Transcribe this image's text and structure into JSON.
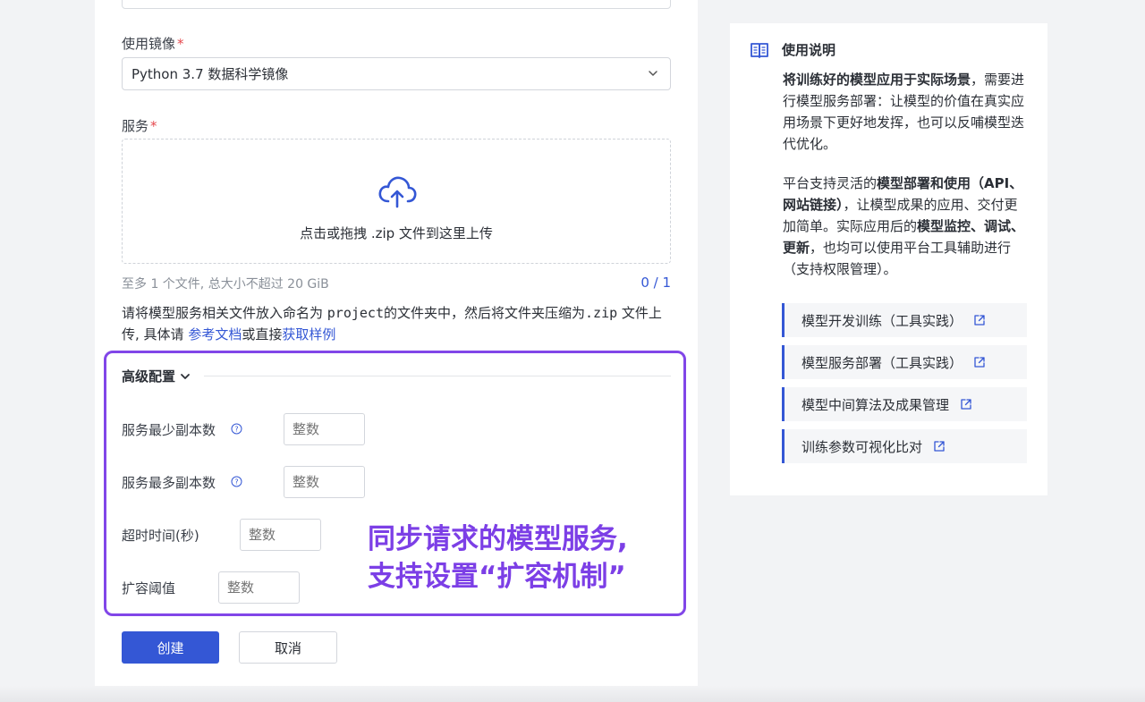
{
  "form": {
    "image_label": "使用镜像",
    "image_value": "Python 3.7 数据科学镜像",
    "service_label": "服务",
    "upload_hint": "点击或拖拽 .zip 文件到这里上传",
    "upload_limit": "至多 1 个文件, 总大小不超过 20 GiB",
    "upload_count": "0 / 1",
    "desc_part1": "请将模型服务相关文件放入命名为 ",
    "desc_code1": "project",
    "desc_part2": "的文件夹中，然后将文件夹压缩为",
    "desc_code2": ".zip",
    "desc_part3": " 文件上传, 具体请 ",
    "desc_link1": "参考文档",
    "desc_part4": "或直接",
    "desc_link2": "获取样例"
  },
  "advanced": {
    "title": "高级配置",
    "fields": [
      {
        "label": "服务最少副本数",
        "placeholder": "整数"
      },
      {
        "label": "服务最多副本数",
        "placeholder": "整数"
      },
      {
        "label": "超时时间(秒)",
        "placeholder": "整数"
      },
      {
        "label": "扩容阈值",
        "placeholder": "整数"
      }
    ],
    "annotation_line1": "同步请求的模型服务,",
    "annotation_line2": "支持设置“扩容机制”"
  },
  "actions": {
    "create": "创建",
    "cancel": "取消"
  },
  "sidebar": {
    "title": "使用说明",
    "p1_bold": "将训练好的模型应用于实际场景",
    "p1_rest": "，需要进行模型服务部署：让模型的价值在真实应用场景下更好地发挥，也可以反哺模型迭代优化。",
    "p2_a": "平台支持灵活的",
    "p2_b": "模型部署和使用（API、网站链接）",
    "p2_c": "，让模型成果的应用、交付更加简单。实际应用后的",
    "p2_d": "模型监控、调试、更新",
    "p2_e": "，也均可以使用平台工具辅助进行（支持权限管理）。",
    "links": [
      "模型开发训练（工具实践）",
      "模型服务部署（工具实践）",
      "模型中间算法及成果管理",
      "训练参数可视化比对"
    ]
  },
  "colors": {
    "primary": "#3457d5",
    "annotation": "#7c3fe6",
    "required": "#e5484d"
  }
}
